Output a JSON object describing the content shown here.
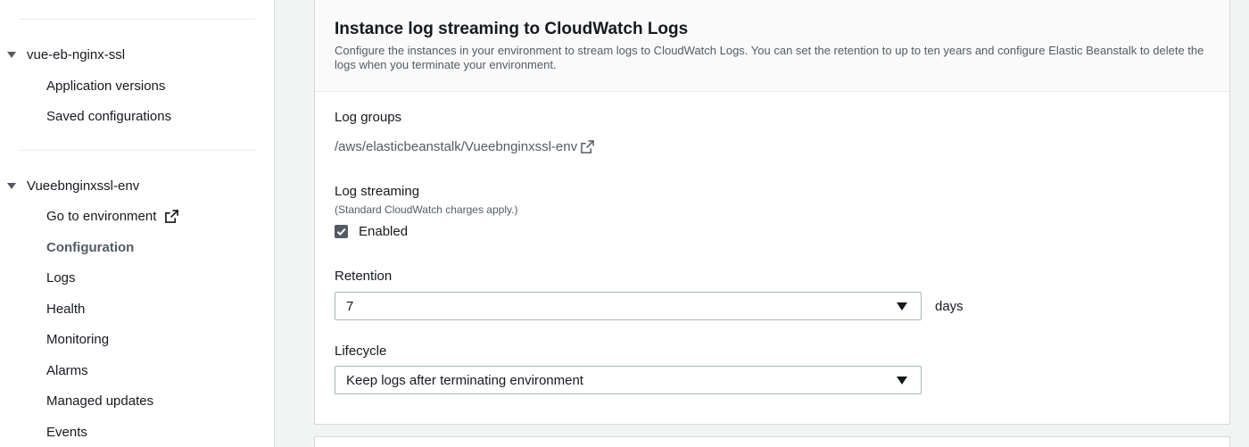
{
  "sidebar": {
    "app_group": {
      "name": "vue-eb-nginx-ssl",
      "items": [
        {
          "label": "Application versions"
        },
        {
          "label": "Saved configurations"
        }
      ]
    },
    "env_group": {
      "name": "Vueebnginxssl-env",
      "items": [
        {
          "label": "Go to environment",
          "external": true
        },
        {
          "label": "Configuration",
          "active": true
        },
        {
          "label": "Logs"
        },
        {
          "label": "Health"
        },
        {
          "label": "Monitoring"
        },
        {
          "label": "Alarms"
        },
        {
          "label": "Managed updates"
        },
        {
          "label": "Events"
        }
      ]
    }
  },
  "panel": {
    "title": "Instance log streaming to CloudWatch Logs",
    "description": "Configure the instances in your environment to stream logs to CloudWatch Logs. You can set the retention to up to ten years and configure Elastic Beanstalk to delete the logs when you terminate your environment.",
    "log_groups": {
      "label": "Log groups",
      "link": "/aws/elasticbeanstalk/Vueebnginxssl-env",
      "icon": "external-link-icon"
    },
    "log_streaming": {
      "label": "Log streaming",
      "note": "(Standard CloudWatch charges apply.)",
      "checkbox_label": "Enabled",
      "checked": true
    },
    "retention": {
      "label": "Retention",
      "value": "7",
      "suffix": "days"
    },
    "lifecycle": {
      "label": "Lifecycle",
      "value": "Keep logs after terminating environment"
    }
  },
  "colors": {
    "accent": "#545b64",
    "border": "#aab7b8",
    "background": "#f2f3f3"
  }
}
